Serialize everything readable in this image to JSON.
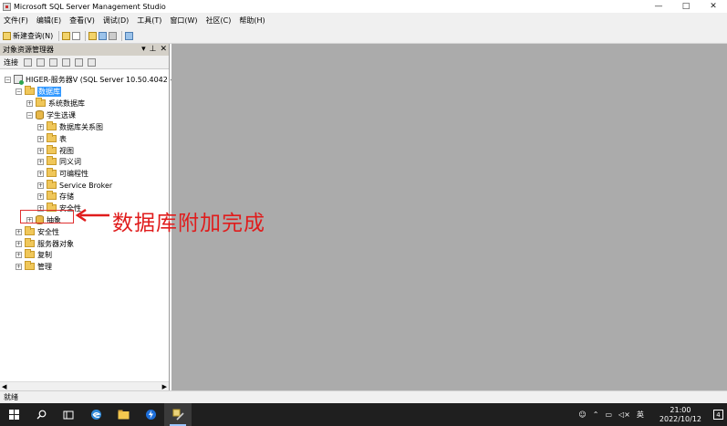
{
  "window": {
    "title": "Microsoft SQL Server Management Studio",
    "min": "—",
    "max": "□",
    "close": "✕"
  },
  "menu": [
    "文件(F)",
    "编辑(E)",
    "查看(V)",
    "调试(D)",
    "工具(T)",
    "窗口(W)",
    "社区(C)",
    "帮助(H)"
  ],
  "toolbar": {
    "new_query": "新建查询(N)"
  },
  "panel": {
    "title": "对象资源管理器",
    "pin": "↕",
    "close": "✕",
    "connect_label": "连接"
  },
  "tree": {
    "server": "HIGER-服务器V (SQL Server 10.50.4042 -",
    "databases": "数据库",
    "system_dbs": "系统数据库",
    "student_db": "学生选课",
    "db_diagrams": "数据库关系图",
    "tables": "表",
    "views": "视图",
    "synonyms": "同义词",
    "programmability": "可编程性",
    "service_broker": "Service Broker",
    "storage": "存储",
    "db_security": "安全性",
    "attached_db": "抽象",
    "security": "安全性",
    "server_objects": "服务器对象",
    "replication": "复制",
    "management": "管理"
  },
  "annotation": {
    "text": "数据库附加完成",
    "color": "#e01c1c"
  },
  "status": {
    "text": "就绪"
  },
  "taskbar": {
    "tray_lang": "英",
    "time": "21:00",
    "date": "2022/10/12",
    "notif_count": "4"
  },
  "colors": {
    "workspace": "#ababab",
    "selection": "#3399ff",
    "taskbar": "#1f1f1f"
  }
}
